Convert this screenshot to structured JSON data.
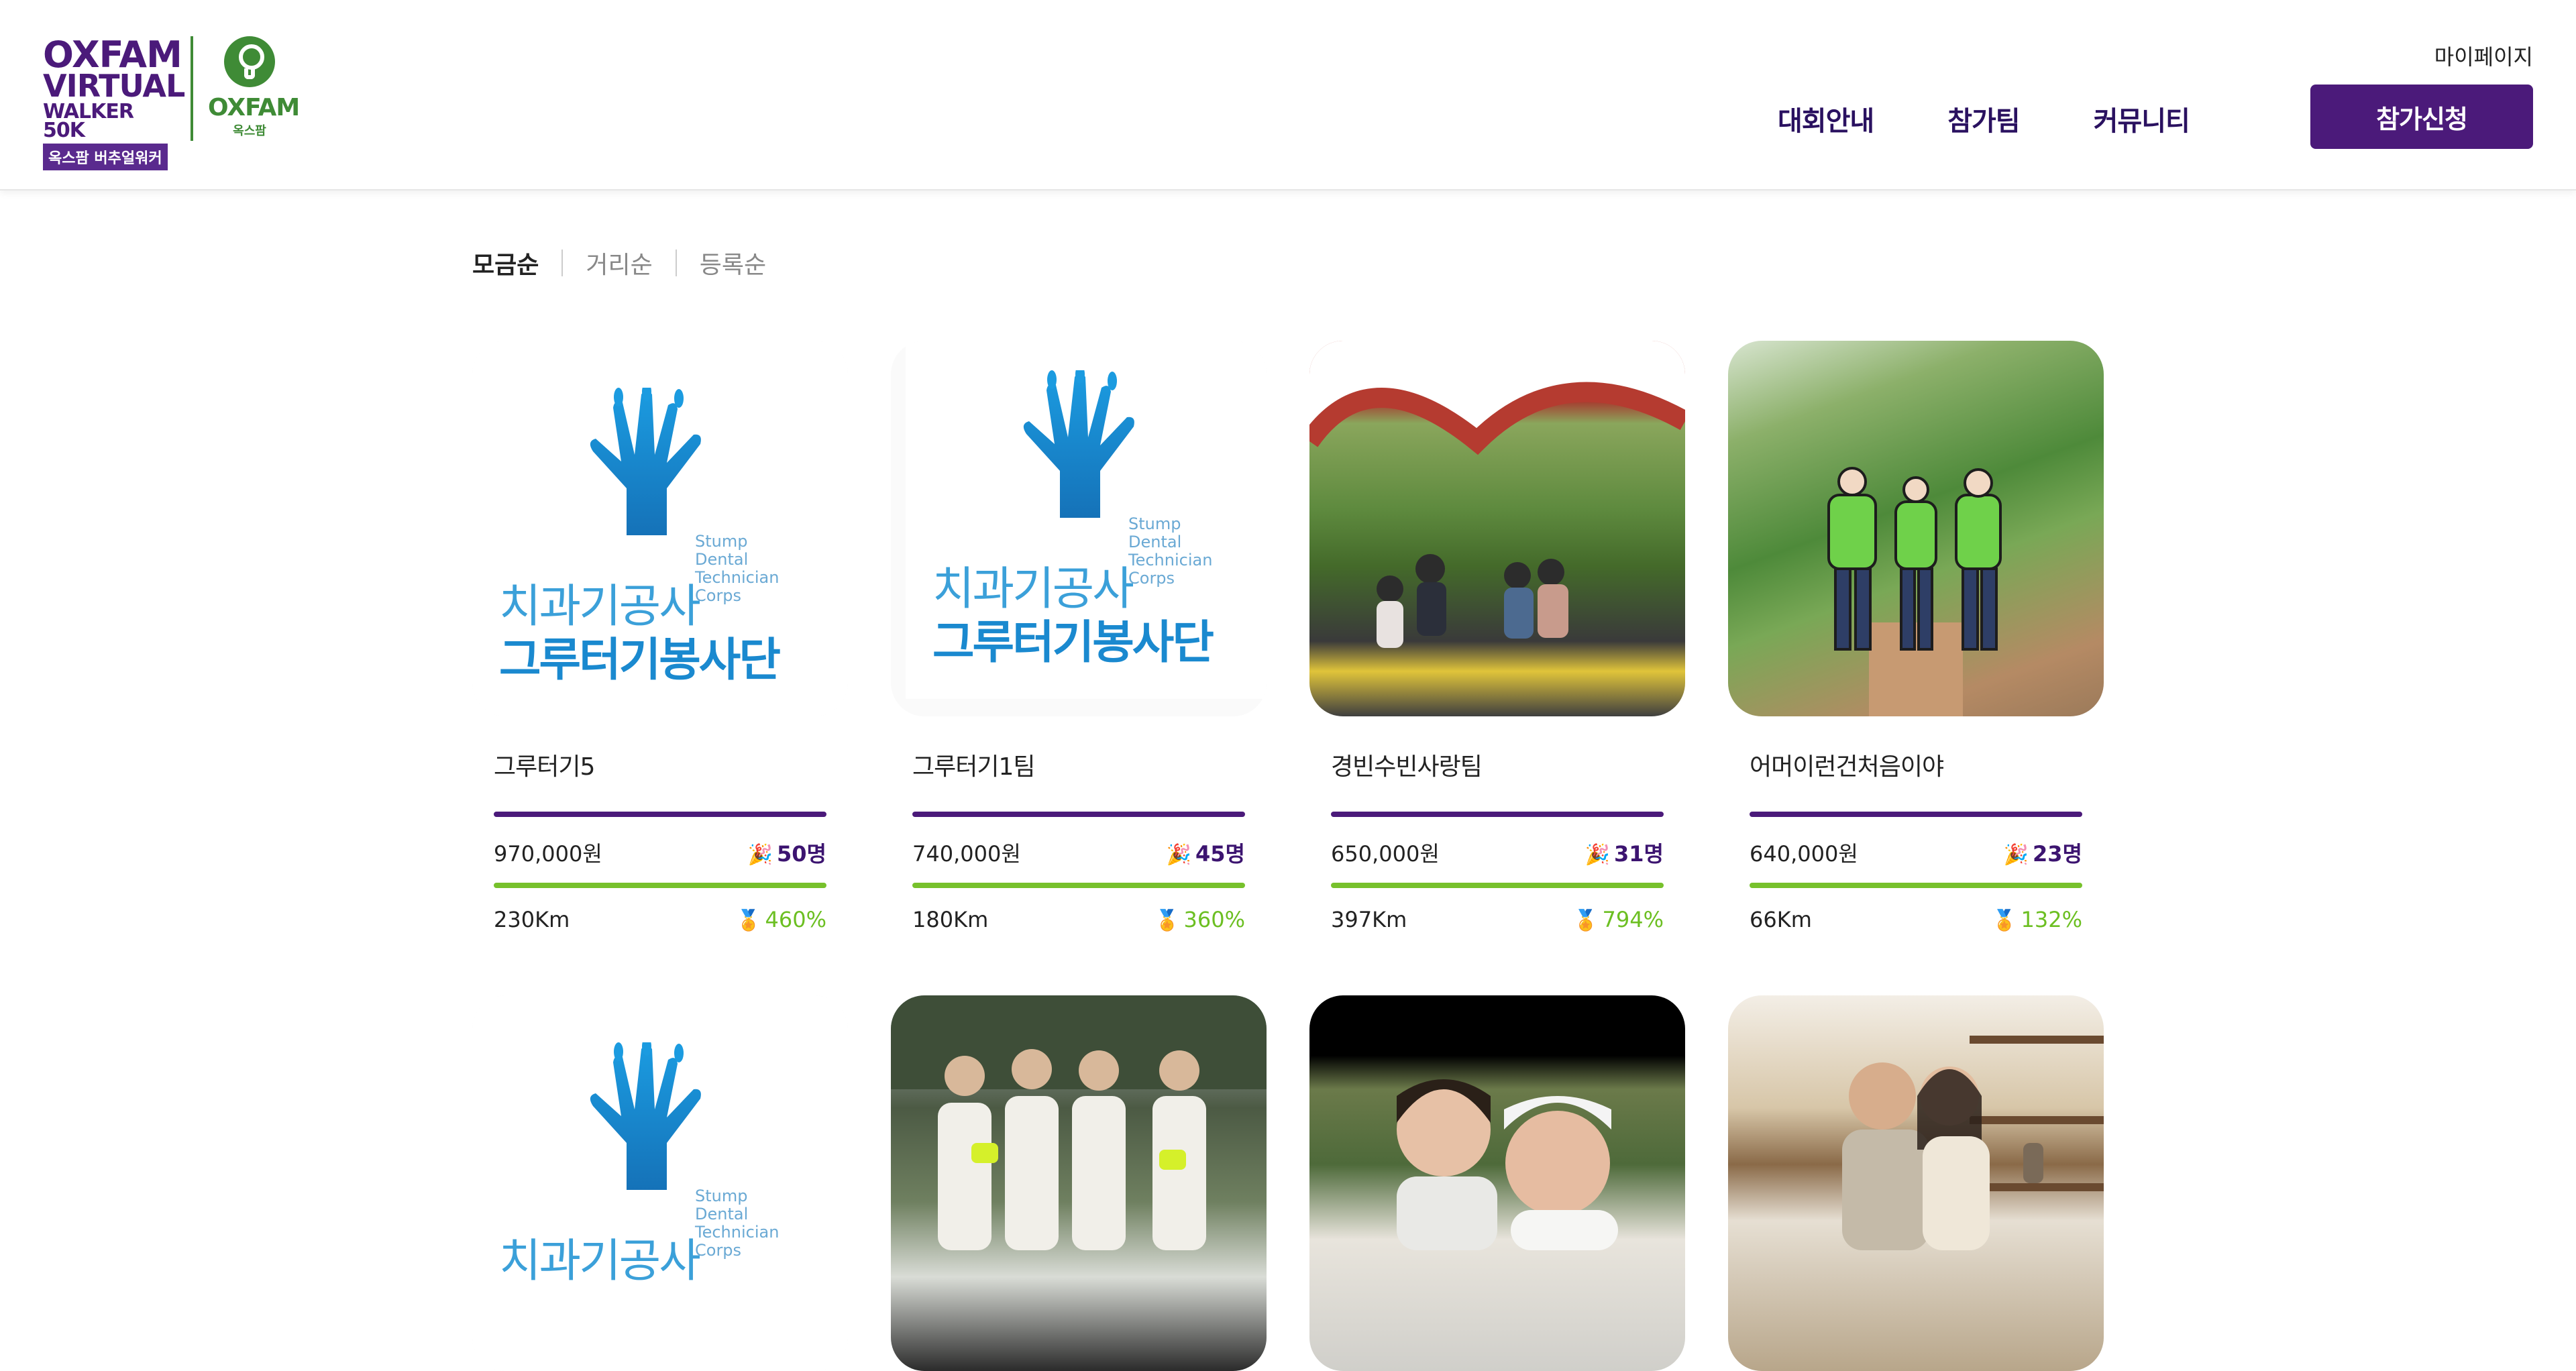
{
  "brand": {
    "event_logo_lines": [
      "OXFAM",
      "VIRTUAL",
      "WALKER 50K"
    ],
    "event_logo_band": "옥스팜 버추얼워커",
    "org_logo_word": "OXFAM",
    "org_logo_ko": "옥스팜",
    "primary_color": "#4b1a7a",
    "green_color": "#77c12c"
  },
  "header": {
    "mypage": "마이페이지",
    "nav": [
      "대회안내",
      "참가팀",
      "커뮤니티"
    ],
    "apply_button": "참가신청"
  },
  "sort": {
    "options": [
      "모금순",
      "거리순",
      "등록순"
    ],
    "active": "모금순"
  },
  "dental_logo": {
    "ko_line1": "치과기공사",
    "ko_line2": "그루터기봉사단",
    "en_lines": [
      "Stump",
      "Dental",
      "Technician",
      "Corps"
    ]
  },
  "teams": [
    {
      "name": "그루터기5",
      "amount": "970,000원",
      "members": "50명",
      "distance": "230Km",
      "percent": "460%",
      "image": "dental-logo"
    },
    {
      "name": "그루터기1팀",
      "amount": "740,000원",
      "members": "45명",
      "distance": "180Km",
      "percent": "360%",
      "image": "dental-logo"
    },
    {
      "name": "경빈수빈사랑팀",
      "amount": "650,000원",
      "members": "31명",
      "distance": "397Km",
      "percent": "794%",
      "image": "photo-heart-bench"
    },
    {
      "name": "어머이런건처음이야",
      "amount": "640,000원",
      "members": "23명",
      "distance": "66Km",
      "percent": "132%",
      "image": "illustration-three-walkers"
    }
  ],
  "second_row_images": [
    "dental-logo",
    "photo-group-hikers",
    "photo-two-women-selfie",
    "photo-couple-indoor"
  ],
  "icons": {
    "members": "party-popper-icon",
    "percent": "medal-icon"
  }
}
